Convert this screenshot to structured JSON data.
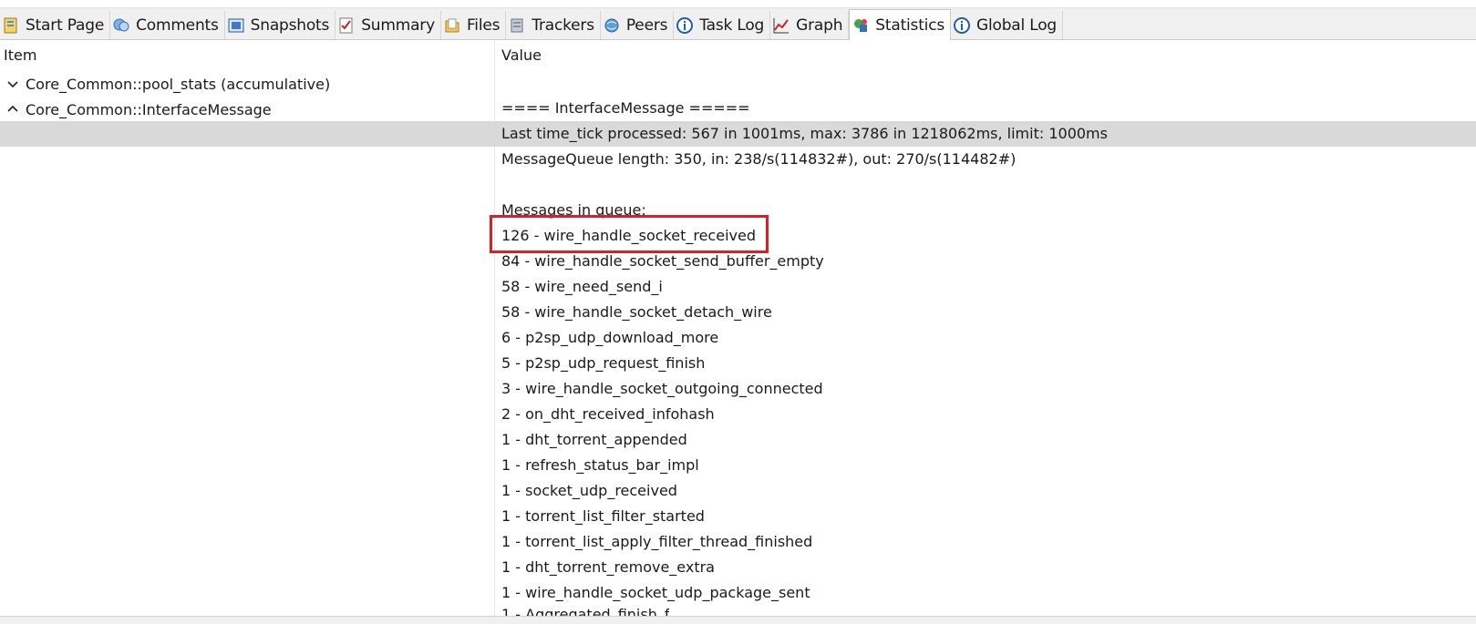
{
  "tabs": [
    {
      "label": "Start Page",
      "icon": "start-page-icon"
    },
    {
      "label": "Comments",
      "icon": "comments-icon"
    },
    {
      "label": "Snapshots",
      "icon": "snapshots-icon"
    },
    {
      "label": "Summary",
      "icon": "summary-icon"
    },
    {
      "label": "Files",
      "icon": "files-icon"
    },
    {
      "label": "Trackers",
      "icon": "trackers-icon"
    },
    {
      "label": "Peers",
      "icon": "peers-icon"
    },
    {
      "label": "Task Log",
      "icon": "info-icon"
    },
    {
      "label": "Graph",
      "icon": "graph-icon"
    },
    {
      "label": "Statistics",
      "icon": "statistics-icon",
      "active": true
    },
    {
      "label": "Global Log",
      "icon": "info-icon"
    }
  ],
  "columns": {
    "item": "Item",
    "value": "Value"
  },
  "tree": [
    {
      "label": "Core_Common::pool_stats (accumulative)",
      "expanded": false
    },
    {
      "label": "Core_Common::InterfaceMessage",
      "expanded": true
    }
  ],
  "values": [
    "==== InterfaceMessage =====",
    "Last time_tick processed: 567 in 1001ms, max: 3786 in 1218062ms, limit: 1000ms",
    "MessageQueue length: 350, in: 238/s(114832#), out: 270/s(114482#)",
    "",
    "Messages in queue:",
    "126 - wire_handle_socket_received",
    "84 - wire_handle_socket_send_buffer_empty",
    "58 - wire_need_send_i",
    "58 - wire_handle_socket_detach_wire",
    "6 - p2sp_udp_download_more",
    "5 - p2sp_udp_request_finish",
    "3 - wire_handle_socket_outgoing_connected",
    "2 - on_dht_received_infohash",
    "1 - dht_torrent_appended",
    "1 - refresh_status_bar_impl",
    "1 - socket_udp_received",
    "1 - torrent_list_filter_started",
    "1 - torrent_list_apply_filter_thread_finished",
    "1 - dht_torrent_remove_extra",
    "1 - wire_handle_socket_udp_package_sent"
  ],
  "partial_line": "1 - Aggregated_finish_f",
  "selected_value_index": 1,
  "highlighted_value_index": 5,
  "colors": {
    "highlight_border": "#d6202a",
    "selection": "#d9d9d9"
  }
}
